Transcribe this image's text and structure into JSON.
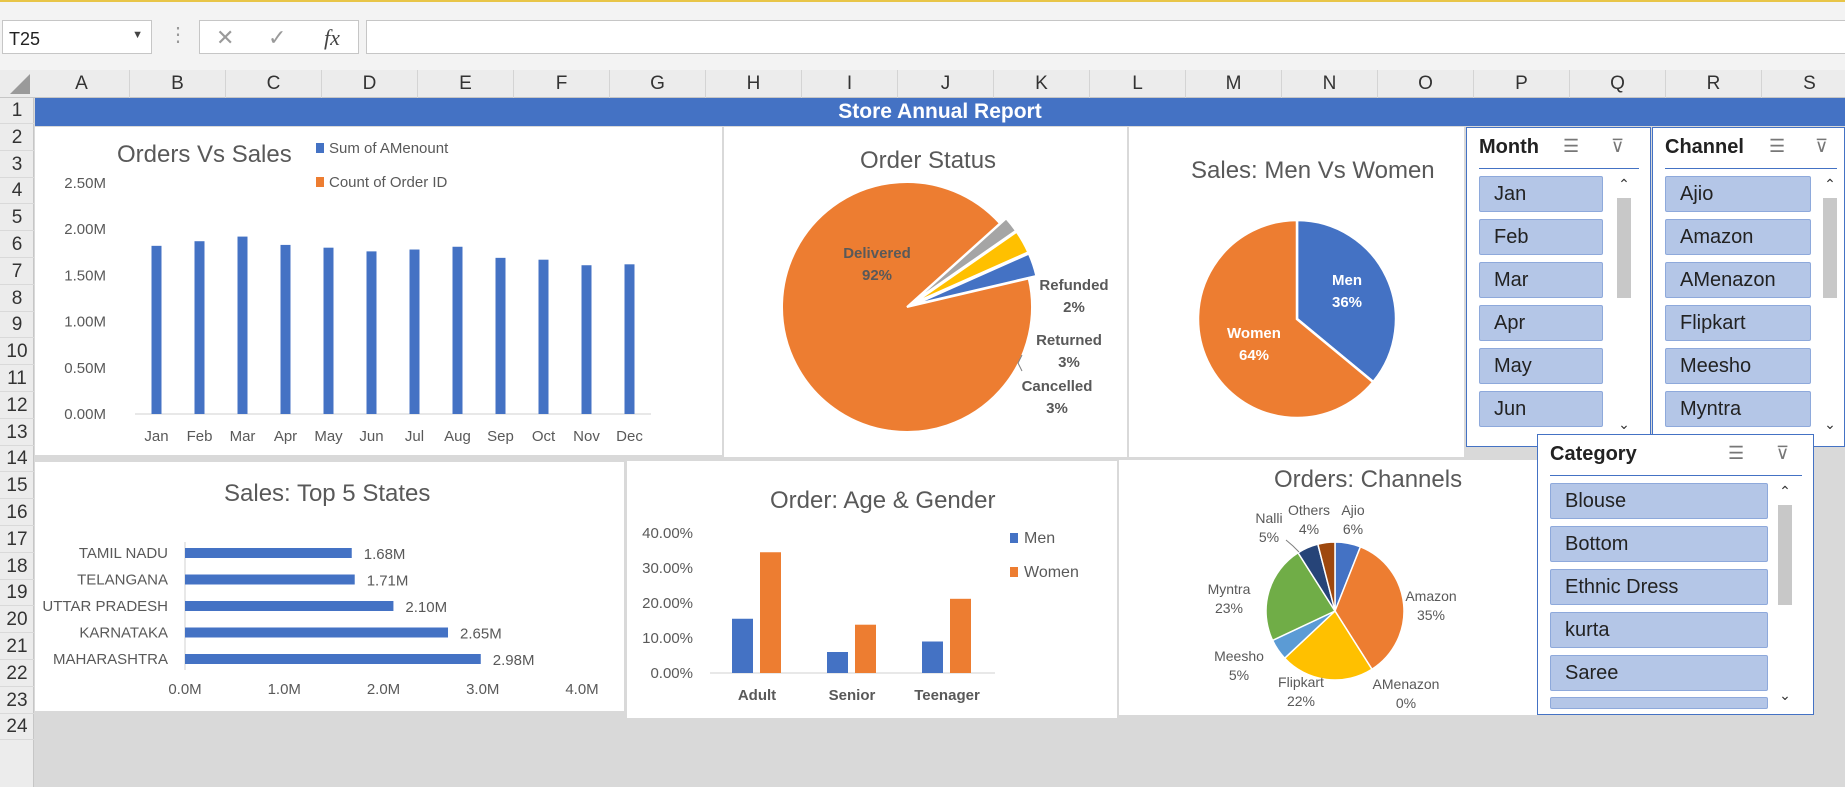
{
  "app": {
    "name_box": "T25",
    "fx_label": "fx",
    "cancel_glyph": "✕",
    "enter_glyph": "✓"
  },
  "columns": [
    "A",
    "B",
    "C",
    "D",
    "E",
    "F",
    "G",
    "H",
    "I",
    "J",
    "K",
    "L",
    "M",
    "N",
    "O",
    "P",
    "Q",
    "R",
    "S"
  ],
  "rows": [
    "1",
    "2",
    "3",
    "4",
    "5",
    "6",
    "7",
    "8",
    "9",
    "10",
    "11",
    "12",
    "13",
    "14",
    "15",
    "16",
    "17",
    "18",
    "19",
    "20",
    "21",
    "22",
    "23",
    "24"
  ],
  "banner": "Store Annual Report",
  "colors": {
    "blue": "#4472c4",
    "orange": "#ed7d31",
    "gray": "#a5a5a5",
    "yellow": "#ffc000",
    "light_blue": "#5b9bd5",
    "green": "#70ad47",
    "navy": "#264478",
    "brown": "#9e480e"
  },
  "chart_data": [
    {
      "type": "bar",
      "title": "Orders Vs Sales",
      "categories": [
        "Jan",
        "Feb",
        "Mar",
        "Apr",
        "May",
        "Jun",
        "Jul",
        "Aug",
        "Sep",
        "Oct",
        "Nov",
        "Dec"
      ],
      "series": [
        {
          "name": "Sum of AMenount",
          "values": [
            1.82,
            1.87,
            1.92,
            1.83,
            1.8,
            1.76,
            1.78,
            1.81,
            1.69,
            1.67,
            1.61,
            1.62
          ]
        },
        {
          "name": "Count of Order ID",
          "values": [
            0,
            0,
            0,
            0,
            0,
            0,
            0,
            0,
            0,
            0,
            0,
            0
          ]
        }
      ],
      "yticks": [
        "0.00M",
        "0.50M",
        "1.00M",
        "1.50M",
        "2.00M",
        "2.50M"
      ],
      "ylim": [
        0,
        2.5
      ]
    },
    {
      "type": "pie",
      "title": "Order Status",
      "labels": [
        "Delivered",
        "Refunded",
        "Returned",
        "Cancelled"
      ],
      "values": [
        92,
        2,
        3,
        3
      ],
      "display": [
        "92%",
        "2%",
        "3%",
        "3%"
      ]
    },
    {
      "type": "pie",
      "title": "Sales: Men Vs Women",
      "labels": [
        "Men",
        "Women"
      ],
      "values": [
        36,
        64
      ],
      "display": [
        "36%",
        "64%"
      ]
    },
    {
      "type": "bar",
      "title": "Sales: Top 5 States",
      "categories": [
        "TAMIL NADU",
        "TELANGANA",
        "UTTAR PRADESH",
        "KARNATAKA",
        "MAHARASHTRA"
      ],
      "values": [
        1.68,
        1.71,
        2.1,
        2.65,
        2.98
      ],
      "data_labels": [
        "1.68M",
        "1.71M",
        "2.10M",
        "2.65M",
        "2.98M"
      ],
      "xticks": [
        "0.0M",
        "1.0M",
        "2.0M",
        "3.0M",
        "4.0M"
      ],
      "xlim": [
        0,
        4
      ]
    },
    {
      "type": "bar",
      "title": "Order: Age & Gender",
      "categories": [
        "Adult",
        "Senior",
        "Teenager"
      ],
      "series": [
        {
          "name": "Men",
          "values": [
            15.5,
            6.0,
            9.0
          ]
        },
        {
          "name": "Women",
          "values": [
            34.5,
            13.8,
            21.2
          ]
        }
      ],
      "yticks": [
        "0.00%",
        "10.00%",
        "20.00%",
        "30.00%",
        "40.00%"
      ],
      "ylim": [
        0,
        40
      ]
    },
    {
      "type": "pie",
      "title": "Orders: Channels",
      "labels": [
        "Ajio",
        "Amazon",
        "AMenazon",
        "Flipkart",
        "Meesho",
        "Myntra",
        "Nalli",
        "Others"
      ],
      "values": [
        6,
        35,
        0,
        22,
        5,
        23,
        5,
        4
      ],
      "display": [
        "6%",
        "35%",
        "0%",
        "22%",
        "5%",
        "23%",
        "5%",
        "4%"
      ]
    }
  ],
  "slicers": {
    "month": {
      "title": "Month",
      "items": [
        "Jan",
        "Feb",
        "Mar",
        "Apr",
        "May",
        "Jun"
      ]
    },
    "channel": {
      "title": "Channel",
      "items": [
        "Ajio",
        "Amazon",
        "AMenazon",
        "Flipkart",
        "Meesho",
        "Myntra"
      ]
    },
    "category": {
      "title": "Category",
      "items": [
        "Blouse",
        "Bottom",
        "Ethnic Dress",
        "kurta",
        "Saree"
      ]
    }
  }
}
